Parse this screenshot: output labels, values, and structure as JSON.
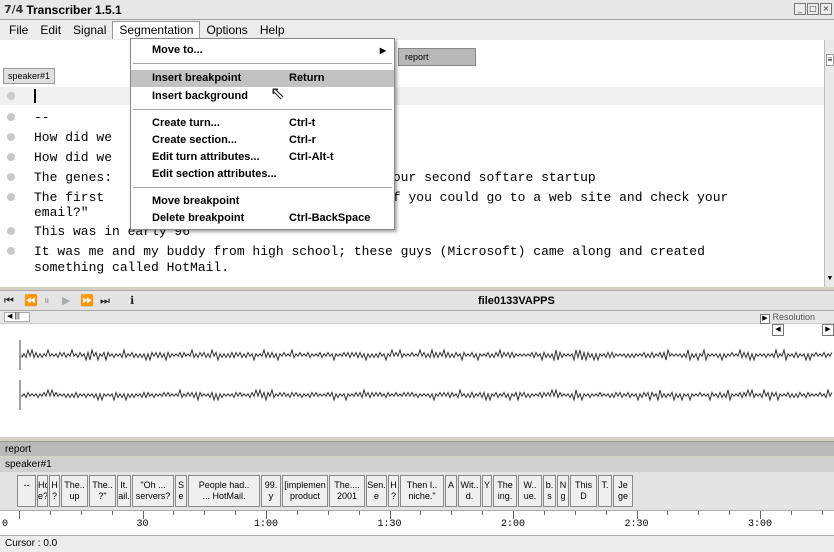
{
  "window": {
    "title": "Transcriber 1.5.1",
    "app_icon": "7/4"
  },
  "menubar": [
    "File",
    "Edit",
    "Signal",
    "Segmentation",
    "Options",
    "Help"
  ],
  "segmentation_menu": [
    {
      "label": "Move to...",
      "shortcut": "",
      "submenu": true
    },
    {
      "label": "Insert breakpoint",
      "shortcut": "Return",
      "highlighted": true
    },
    {
      "label": "Insert background",
      "shortcut": ""
    },
    {
      "label": "Create turn...",
      "shortcut": "Ctrl-t"
    },
    {
      "label": "Create section...",
      "shortcut": "Ctrl-r"
    },
    {
      "label": "Edit turn attributes...",
      "shortcut": "Ctrl-Alt-t"
    },
    {
      "label": "Edit section attributes...",
      "shortcut": ""
    },
    {
      "label": "Move breakpoint",
      "shortcut": ""
    },
    {
      "label": "Delete breakpoint",
      "shortcut": "Ctrl-BackSpace"
    }
  ],
  "editor": {
    "section_button": "report",
    "speaker_button": "speaker#1",
    "lines": [
      "",
      "--",
      "How did we",
      "How did we",
      "The genes:                                    our second softare startup",
      "The first                                     f you could go to a web site and check your",
      "email?\"",
      "This was in early 96",
      "It was me and my buddy from high school; these guys (Microsoft) came along and created",
      "something called HotMail."
    ]
  },
  "transport": {
    "file_name": "file0133VAPPS"
  },
  "wave": {
    "resolution_label": "Resolution"
  },
  "segments": {
    "section_label": "report",
    "speaker_label": "speaker#1",
    "items": [
      [
        "--",
        ""
      ],
      [
        "Ho.",
        "e?"
      ],
      [
        "H",
        "?"
      ],
      [
        "The..",
        "up"
      ],
      [
        "The..",
        "?\""
      ],
      [
        "It.",
        "ail."
      ],
      [
        "\"Oh ...",
        "servers?"
      ],
      [
        "S",
        "e"
      ],
      [
        "People had..",
        "... HotMail."
      ],
      [
        "99.",
        "y"
      ],
      [
        "[implemen",
        "product"
      ],
      [
        "The....",
        "2001"
      ],
      [
        "Sen.",
        "e"
      ],
      [
        "H",
        "?"
      ],
      [
        "Then I..",
        "niche.\""
      ],
      [
        "A",
        ""
      ],
      [
        "Wit..",
        "d."
      ],
      [
        "Y",
        ""
      ],
      [
        "The",
        "ing."
      ],
      [
        "W..",
        "ue."
      ],
      [
        "b.",
        "s"
      ],
      [
        "N",
        "g"
      ],
      [
        "This",
        "D"
      ],
      [
        "T.",
        ""
      ],
      [
        "Je",
        "ge"
      ]
    ]
  },
  "timeline": [
    "0",
    "30",
    "1:00",
    "1:30",
    "2:00",
    "2:30",
    "3:00"
  ],
  "status": {
    "cursor": "Cursor : 0.0"
  }
}
